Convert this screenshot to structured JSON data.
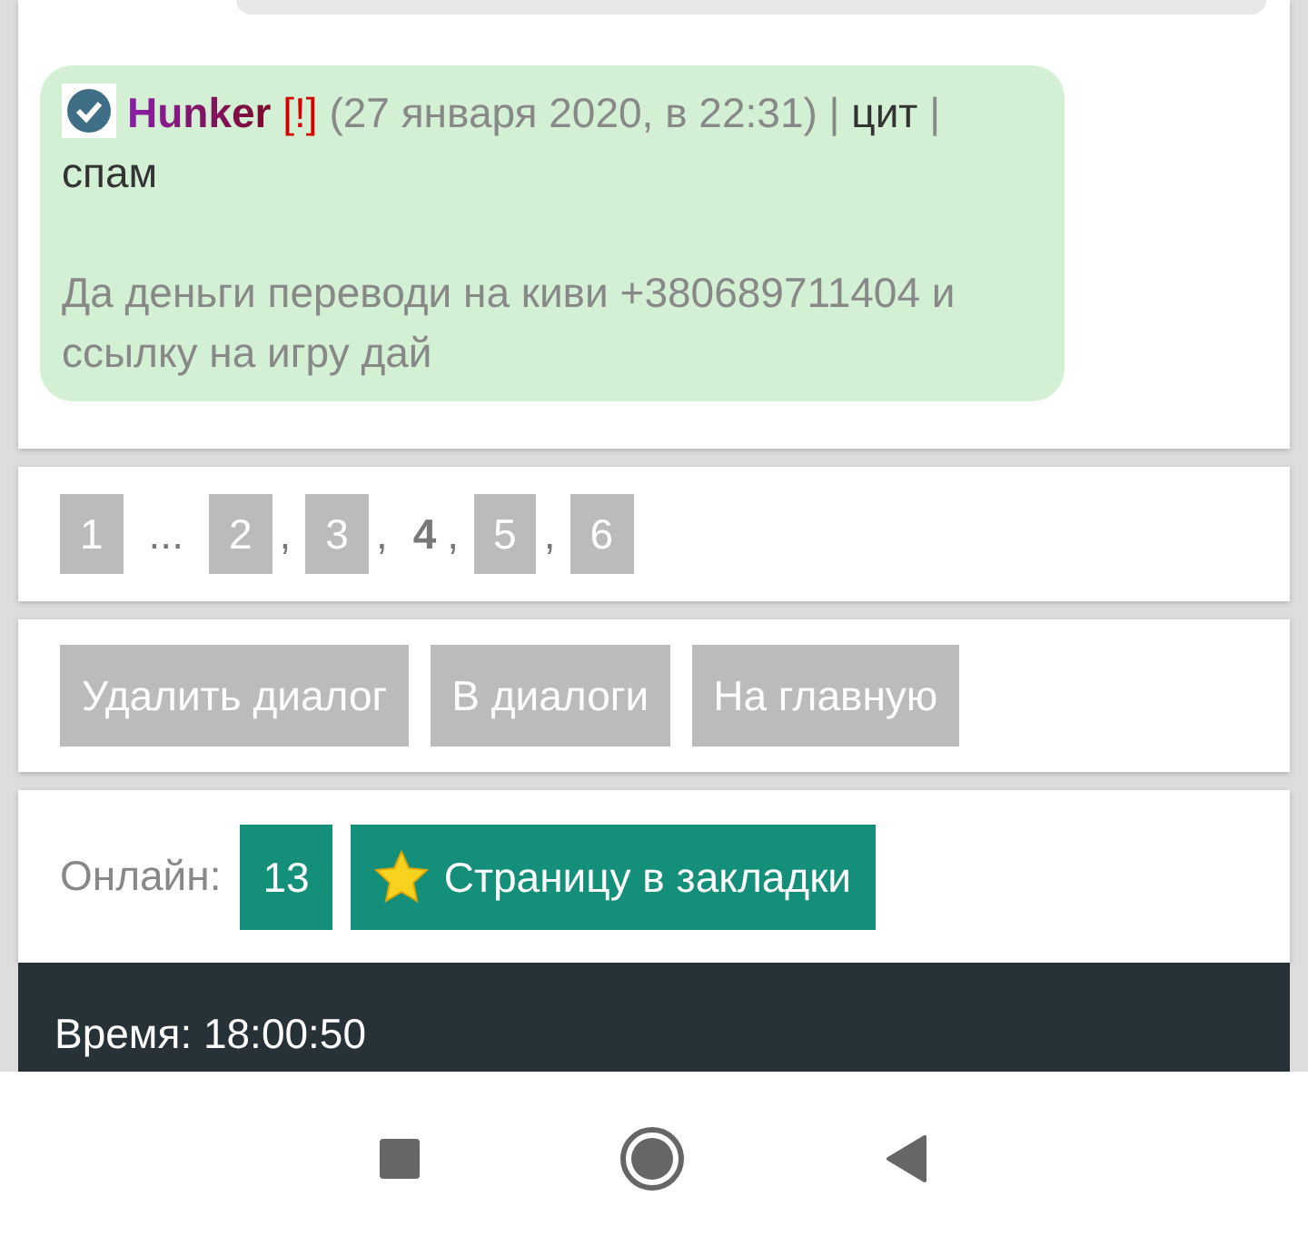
{
  "message": {
    "author": "Hunker",
    "flag": "[!]",
    "date": "(27 января 2020, в 22:31)",
    "sep1": "|",
    "quote": "цит",
    "sep2": "|",
    "spam": "спам",
    "text": "Да деньги переводи на киви +380689711404 и ссылку на игру дай"
  },
  "pagination": [
    {
      "kind": "page",
      "label": "1",
      "selected": false
    },
    {
      "kind": "text",
      "text": "..."
    },
    {
      "kind": "page",
      "label": "2",
      "selected": false
    },
    {
      "kind": "text",
      "text": ","
    },
    {
      "kind": "page",
      "label": "3",
      "selected": false
    },
    {
      "kind": "text",
      "text": ","
    },
    {
      "kind": "page",
      "label": "4",
      "selected": true
    },
    {
      "kind": "text",
      "text": ","
    },
    {
      "kind": "page",
      "label": "5",
      "selected": false
    },
    {
      "kind": "text",
      "text": ","
    },
    {
      "kind": "page",
      "label": "6",
      "selected": false
    }
  ],
  "actions": [
    "Удалить диалог",
    "В диалоги",
    "На главную"
  ],
  "online": {
    "label": "Онлайн:",
    "count": "13",
    "bookmark": "Страницу в закладки"
  },
  "footer": {
    "time": "Время: 18:00:50"
  }
}
